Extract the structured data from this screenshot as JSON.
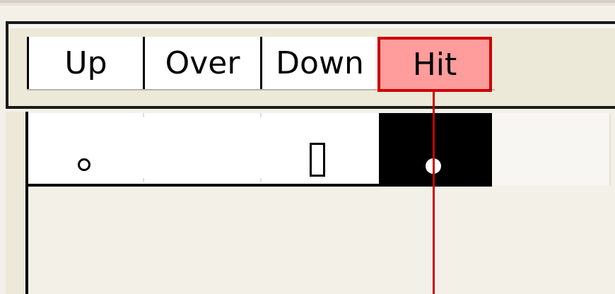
{
  "timeline": {
    "frame_labels": {
      "up": "Up",
      "over": "Over",
      "down": "Down",
      "hit": "Hit"
    },
    "active_frame": "Hit",
    "colors": {
      "active_frame_fill": "#ff9c9c",
      "active_frame_border": "#cc0000",
      "playhead": "#cc0000",
      "selected_frame": "#000000"
    },
    "keyframes": [
      {
        "frame": "Up",
        "marker": "empty-keyframe-circle-icon"
      },
      {
        "frame": "Down",
        "marker": "end-frame-rect-icon"
      },
      {
        "frame": "Hit",
        "marker": "keyframe-dot-icon"
      }
    ]
  }
}
